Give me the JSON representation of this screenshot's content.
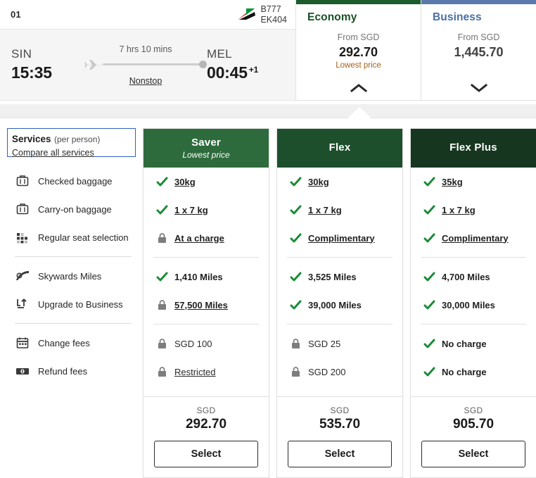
{
  "flight": {
    "segment_number": "01",
    "aircraft": "B777",
    "flight_number": "EK404",
    "airline_logo": "emirates-tailfin-icon",
    "departure": {
      "code": "SIN",
      "time": "15:35"
    },
    "arrival": {
      "code": "MEL",
      "time": "00:45",
      "day_offset": "+1"
    },
    "duration": "7 hrs 10 mins",
    "stops": "Nonstop"
  },
  "cabins": [
    {
      "name": "Economy",
      "from_label": "From SGD",
      "price": "292.70",
      "lowest_tag": "Lowest price",
      "accent_color": "#1d5c2c",
      "name_color": "#194f27",
      "expanded": true,
      "chevron": "chevron-up-icon"
    },
    {
      "name": "Business",
      "from_label": "From SGD",
      "price": "1,445.70",
      "lowest_tag": "",
      "accent_color": "#5b79ad",
      "name_color": "#4a6fa5",
      "expanded": false,
      "chevron": "chevron-down-icon"
    }
  ],
  "services": {
    "title": "Services",
    "subtitle": "(per person)",
    "compare_link": "Compare all services",
    "rows": [
      {
        "label": "Checked baggage",
        "icon": "suitcase-icon"
      },
      {
        "label": "Carry-on baggage",
        "icon": "carryon-bag-icon"
      },
      {
        "label": "Regular seat selection",
        "icon": "seat-grid-icon"
      },
      {
        "label": "Skywards Miles",
        "icon": "miles-swoosh-icon"
      },
      {
        "label": "Upgrade to Business",
        "icon": "seat-upgrade-icon"
      },
      {
        "label": "Change fees",
        "icon": "calendar-icon"
      },
      {
        "label": "Refund fees",
        "icon": "banknote-icon"
      }
    ]
  },
  "fares": [
    {
      "name": "Saver",
      "tagline": "Lowest price",
      "header_color": "#2e6b3c",
      "features": [
        {
          "text": "30kg",
          "icon": "check-icon",
          "link": true
        },
        {
          "text": "1 x 7 kg",
          "icon": "check-icon",
          "link": true
        },
        {
          "text": "At a charge",
          "icon": "lock-icon",
          "link": true
        },
        {
          "text": "1,410 Miles",
          "icon": "check-icon",
          "link": false
        },
        {
          "text": "57,500 Miles",
          "icon": "lock-icon",
          "link": true
        },
        {
          "text": "SGD 100",
          "icon": "lock-icon",
          "link": false
        },
        {
          "text": "Restricted",
          "icon": "lock-icon",
          "link": true
        }
      ],
      "currency": "SGD",
      "amount": "292.70",
      "select_label": "Select"
    },
    {
      "name": "Flex",
      "tagline": "",
      "header_color": "#1d4f2c",
      "features": [
        {
          "text": "30kg",
          "icon": "check-icon",
          "link": true
        },
        {
          "text": "1 x 7 kg",
          "icon": "check-icon",
          "link": true
        },
        {
          "text": "Complimentary",
          "icon": "check-icon",
          "link": true
        },
        {
          "text": "3,525 Miles",
          "icon": "check-icon",
          "link": false
        },
        {
          "text": "39,000 Miles",
          "icon": "check-icon",
          "link": false
        },
        {
          "text": "SGD 25",
          "icon": "lock-icon",
          "link": false
        },
        {
          "text": "SGD 200",
          "icon": "lock-icon",
          "link": false
        }
      ],
      "currency": "SGD",
      "amount": "535.70",
      "select_label": "Select"
    },
    {
      "name": "Flex Plus",
      "tagline": "",
      "header_color": "#16361f",
      "features": [
        {
          "text": "35kg",
          "icon": "check-icon",
          "link": true
        },
        {
          "text": "1 x 7 kg",
          "icon": "check-icon",
          "link": true
        },
        {
          "text": "Complimentary",
          "icon": "check-icon",
          "link": true
        },
        {
          "text": "4,700 Miles",
          "icon": "check-icon",
          "link": false
        },
        {
          "text": "30,000 Miles",
          "icon": "check-icon",
          "link": false
        },
        {
          "text": "No charge",
          "icon": "check-icon",
          "link": false
        },
        {
          "text": "No charge",
          "icon": "check-icon",
          "link": false
        }
      ],
      "currency": "SGD",
      "amount": "905.70",
      "select_label": "Select"
    }
  ],
  "colors": {
    "check_green": "#1a8c37",
    "lock_gray": "#7d7d7d",
    "lowest_price_orange": "#a76119"
  }
}
